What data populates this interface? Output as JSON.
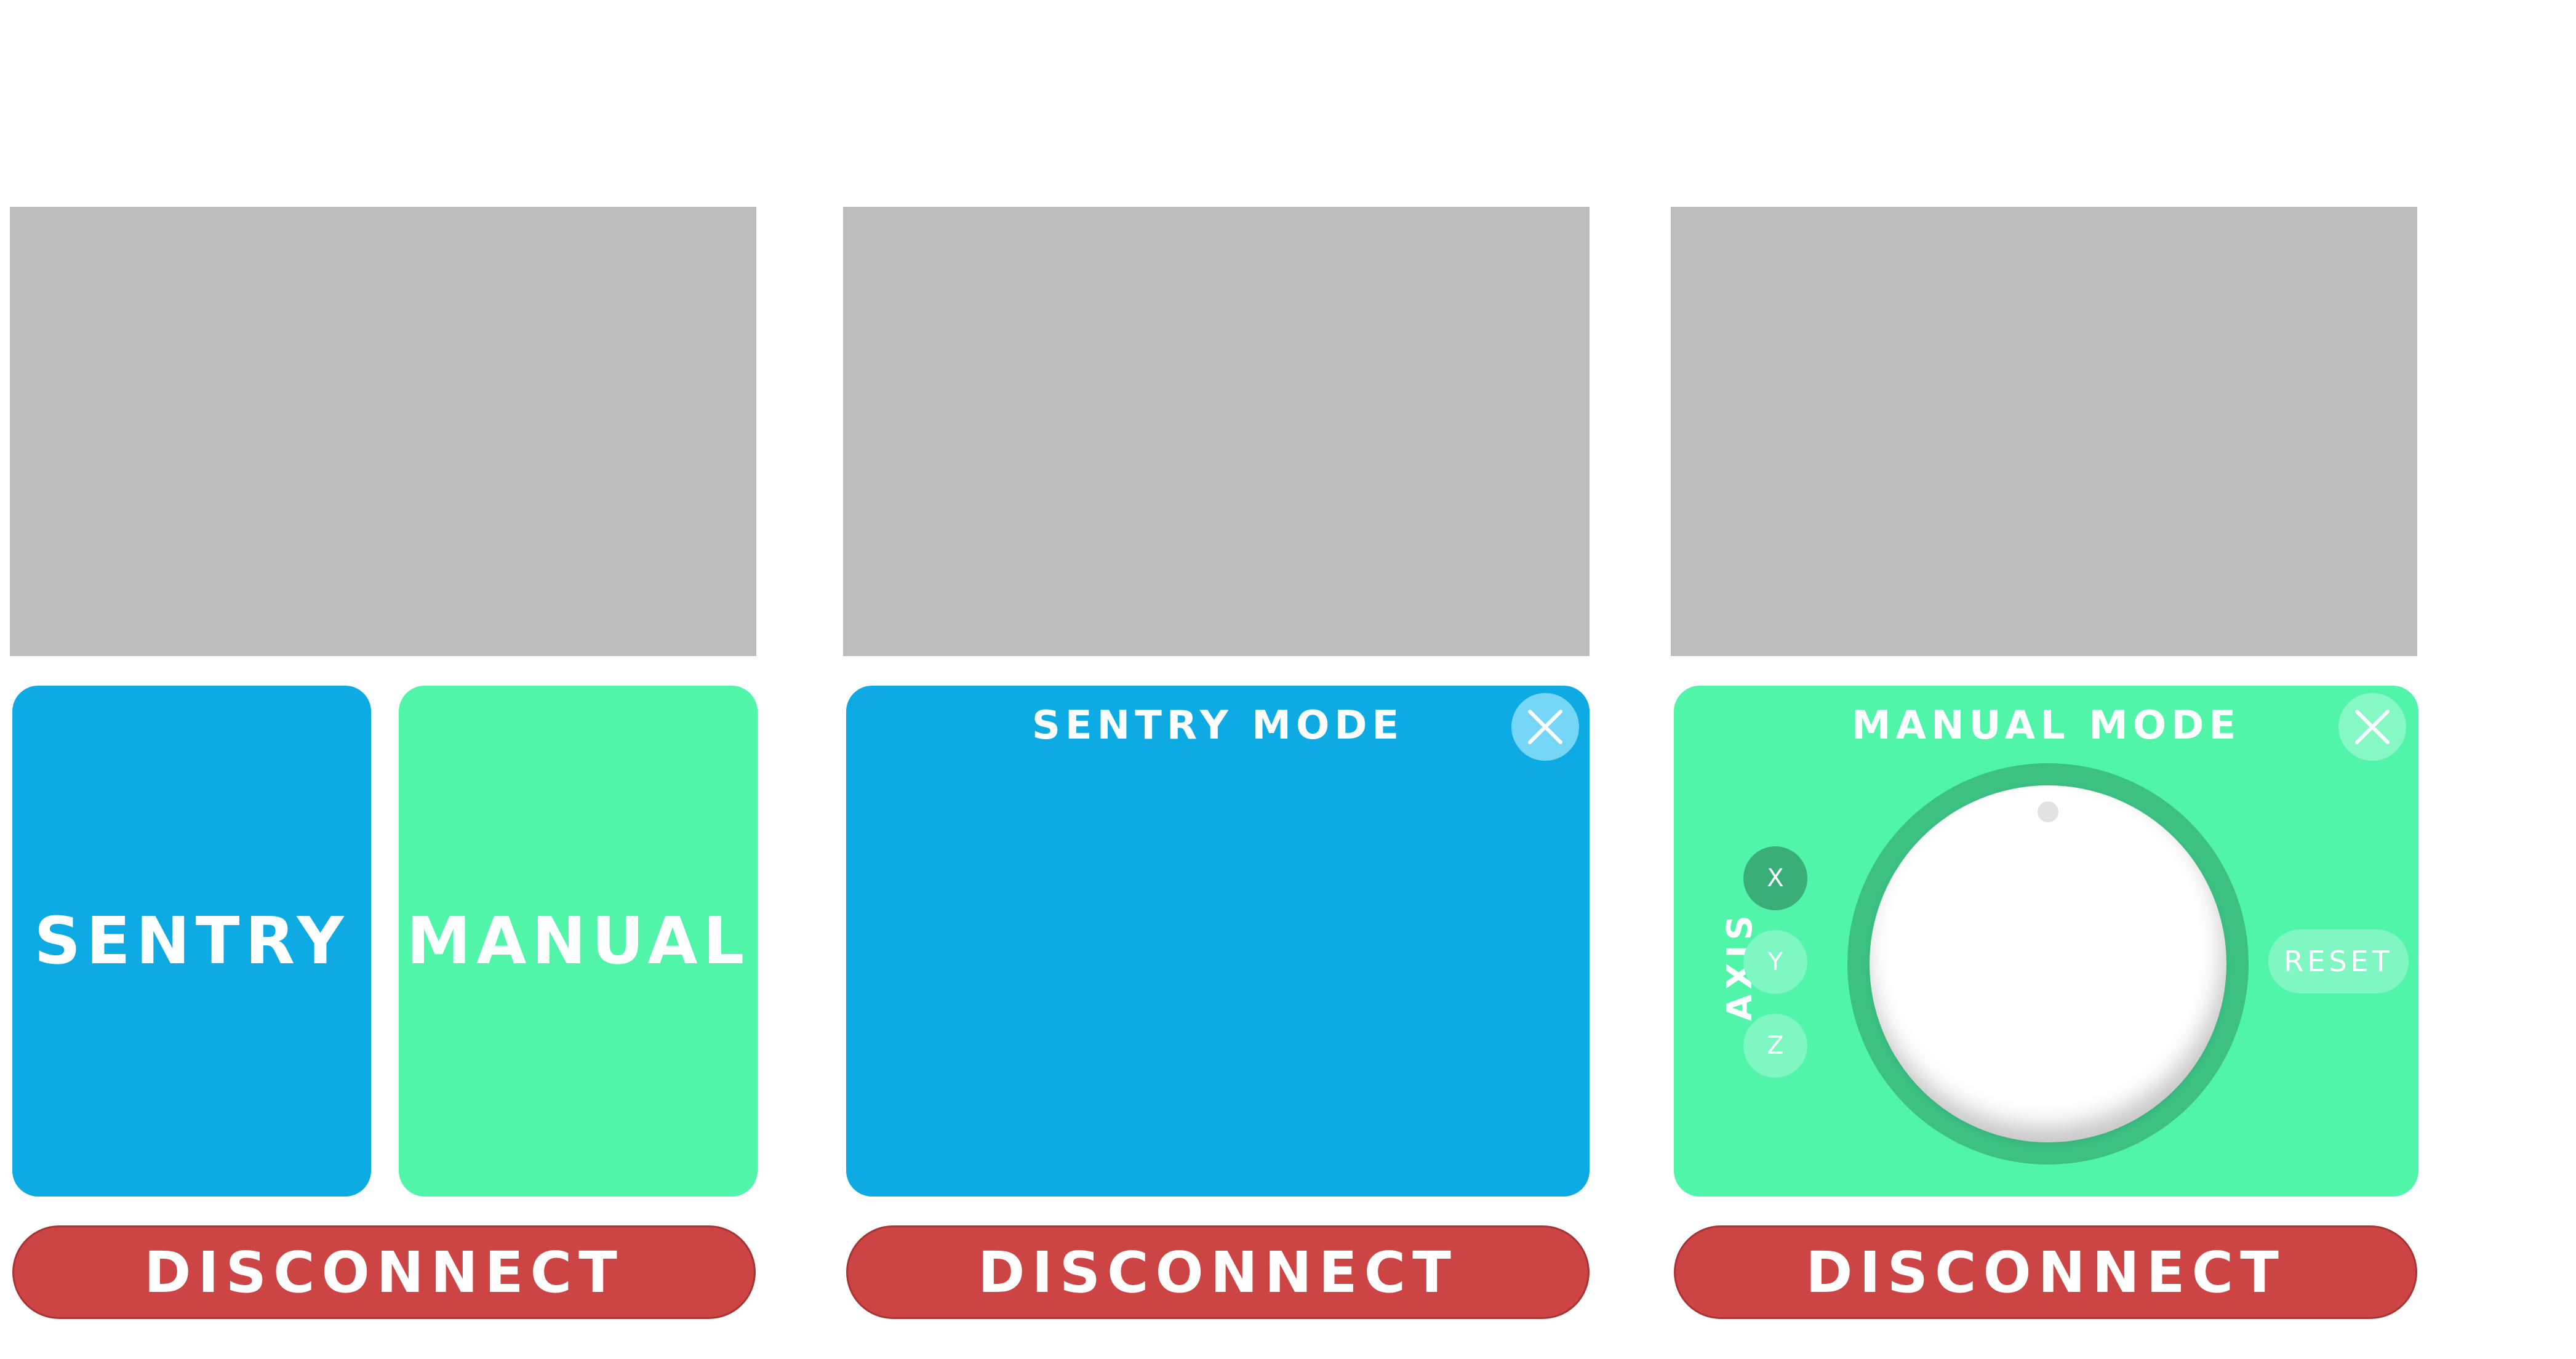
{
  "colors": {
    "video_gray": "#bdbdbd",
    "sentry_blue": "#0eaae3",
    "manual_green": "#50f5a9",
    "disconnect_red": "#cc4444",
    "dial_ring": "#3cc183",
    "axis_selected": "#3aae78",
    "axis_unselected": "#7ef7c2",
    "close_blue_bg": "#76d6f6",
    "close_green_bg": "#86f8c6",
    "reset_bg": "#80f7c2"
  },
  "screens": [
    {
      "mode_buttons": {
        "sentry_label": "SENTRY",
        "manual_label": "MANUAL"
      },
      "disconnect_label": "DISCONNECT"
    },
    {
      "panel": {
        "title": "SENTRY MODE",
        "close_icon": "close-x-icon"
      },
      "disconnect_label": "DISCONNECT"
    },
    {
      "panel": {
        "title": "MANUAL MODE",
        "close_icon": "close-x-icon",
        "axis_label": "AXIS",
        "axis_options": [
          "X",
          "Y",
          "Z"
        ],
        "selected_axis": "X",
        "reset_label": "RESET"
      },
      "disconnect_label": "DISCONNECT"
    }
  ]
}
